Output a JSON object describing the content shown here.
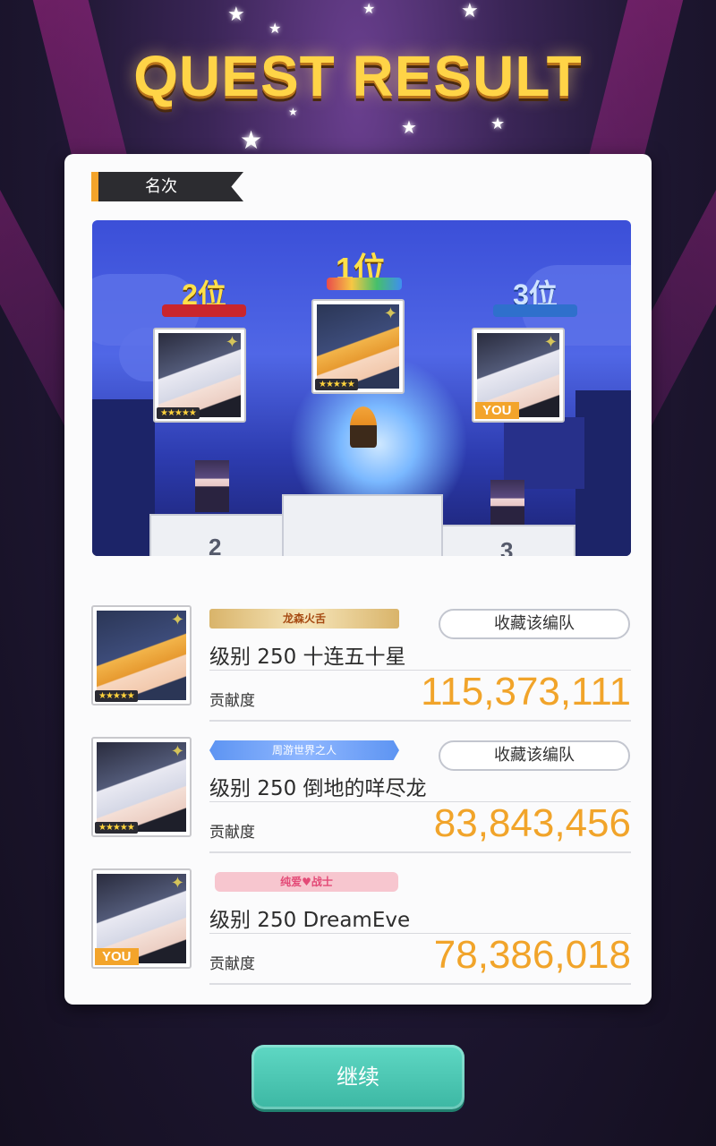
{
  "header": {
    "title": "QUEST RESULT"
  },
  "section": {
    "tag": "名次"
  },
  "podium": {
    "first": {
      "label": "1位",
      "stars": "★★★★★",
      "platform_num": ""
    },
    "second": {
      "label": "2位",
      "stars": "★★★★★",
      "platform_num": "2"
    },
    "third": {
      "label": "3位",
      "you": "YOU",
      "platform_num": "3"
    }
  },
  "results": [
    {
      "badge": "龙森火舌",
      "fav_label": "收藏该编队",
      "name": "级别 250 十连五十星",
      "contrib_label": "贡献度",
      "score": "115,373,111",
      "stars": "★★★★★"
    },
    {
      "badge": "周游世界之人",
      "fav_label": "收藏该编队",
      "name": "级别 250 倒地的咩尽龙",
      "contrib_label": "贡献度",
      "score": "83,843,456",
      "stars": "★★★★★"
    },
    {
      "badge": "纯爱♥战士",
      "name": "级别 250 DreamEve",
      "contrib_label": "贡献度",
      "score": "78,386,018",
      "you": "YOU"
    }
  ],
  "footer": {
    "continue_label": "继续"
  },
  "colors": {
    "accent": "#f1a42a",
    "continue": "#3cb7a3",
    "title": "#ffd447"
  }
}
